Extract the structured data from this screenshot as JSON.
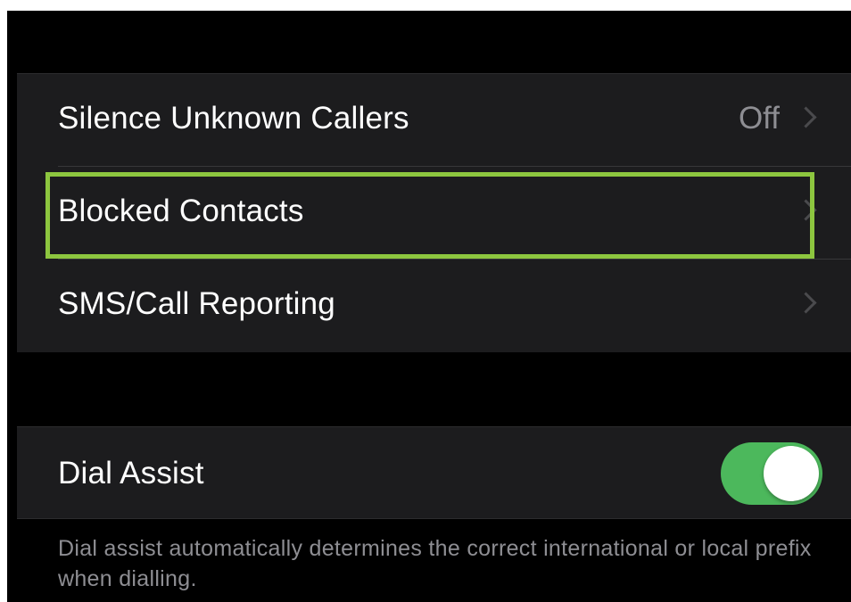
{
  "call_settings": {
    "rows": [
      {
        "label": "Silence Unknown Callers",
        "value": "Off"
      },
      {
        "label": "Blocked Contacts",
        "value": ""
      },
      {
        "label": "SMS/Call Reporting",
        "value": ""
      }
    ]
  },
  "dial_assist": {
    "label": "Dial Assist",
    "enabled": true,
    "footnote": "Dial assist automatically determines the correct international or local prefix when dialling."
  },
  "colors": {
    "background": "#000000",
    "cell": "#1c1c1e",
    "toggle_on": "#4cb85c",
    "highlight": "#8dc63f",
    "secondary_text": "#8e8e93"
  },
  "icons": {
    "disclosure": "chevron-right-icon"
  }
}
